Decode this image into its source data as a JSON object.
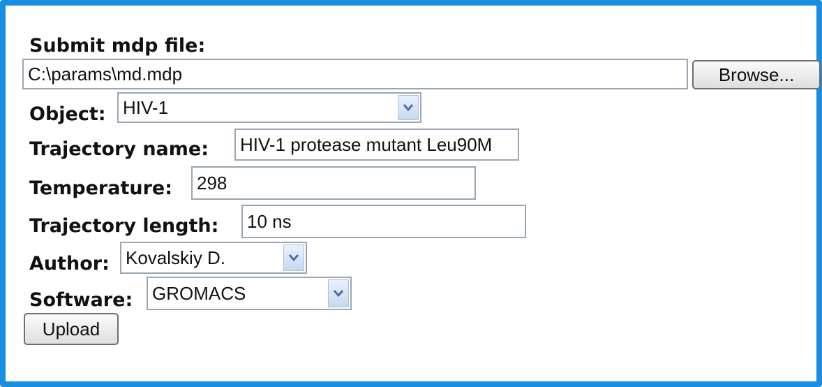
{
  "form": {
    "mdp": {
      "label": "Submit mdp file:",
      "value": "C:\\params\\md.mdp",
      "browse_label": "Browse..."
    },
    "object": {
      "label": "Object:",
      "selected": "HIV-1"
    },
    "trajectory_name": {
      "label": "Trajectory name:",
      "value": "HIV-1 protease mutant Leu90M"
    },
    "temperature": {
      "label": "Temperature:",
      "value": "298"
    },
    "trajectory_length": {
      "label": "Trajectory length:",
      "value": "10 ns"
    },
    "author": {
      "label": "Author:",
      "selected": "Kovalskiy D."
    },
    "software": {
      "label": "Software:",
      "selected": "GROMACS"
    },
    "upload_label": "Upload"
  },
  "colors": {
    "frame_border": "#1a8ee0",
    "field_border": "#9aa6b2",
    "dropdown_arrow": "#4a6fa5"
  },
  "icons": {
    "dropdown": "chevron-down-icon"
  }
}
